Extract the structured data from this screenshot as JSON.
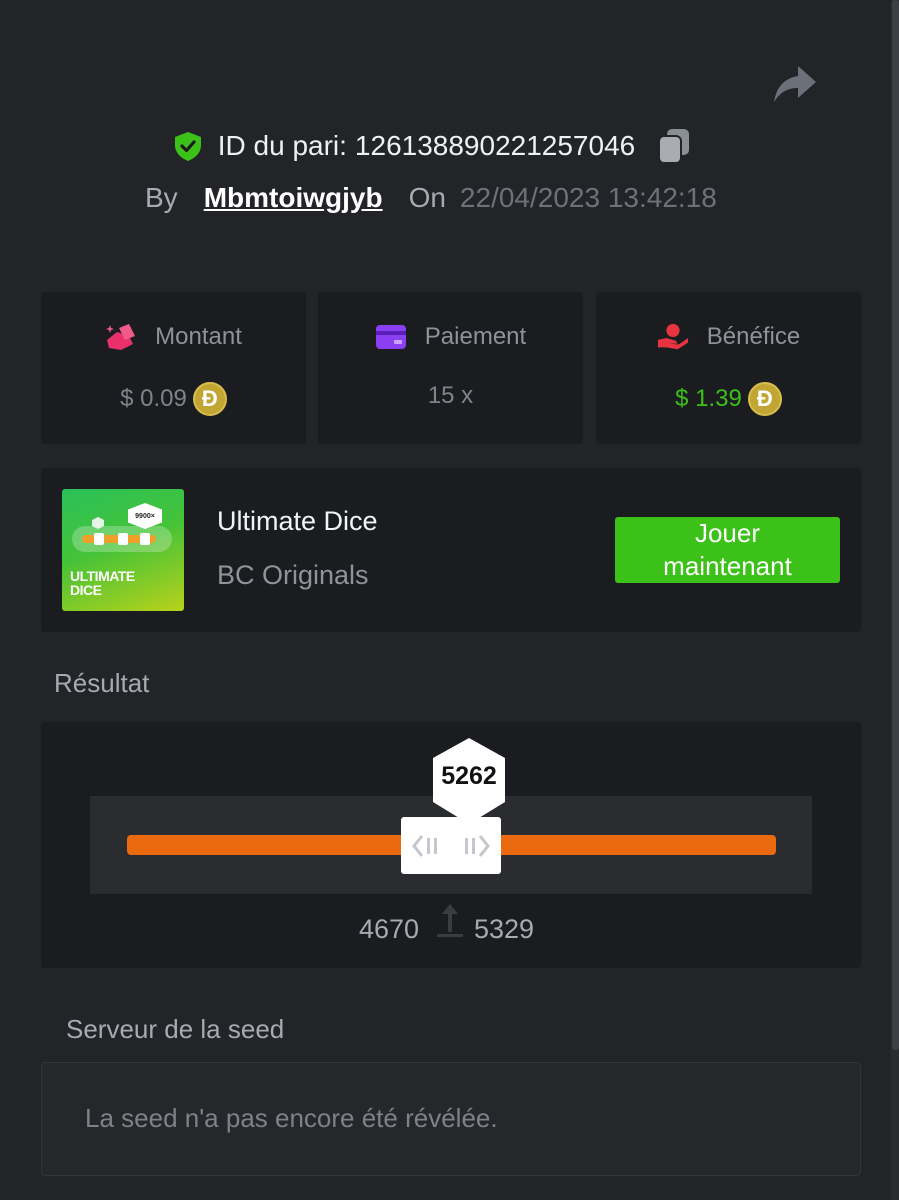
{
  "header": {
    "bet_id_label": "ID du pari:",
    "bet_id": "126138890221257046",
    "by_label": "By",
    "username": "Mbmtoiwgjyb",
    "on_label": "On",
    "datetime": "22/04/2023 13:42:18"
  },
  "stats": {
    "amount": {
      "label": "Montant",
      "value": "$ 0.09",
      "icon": "money-icon",
      "coin": "Đ"
    },
    "payout": {
      "label": "Paiement",
      "value": "15 x",
      "icon": "card-icon"
    },
    "profit": {
      "label": "Bénéfice",
      "value": "$ 1.39",
      "icon": "hand-coin-icon",
      "coin": "Đ"
    }
  },
  "game": {
    "title": "Ultimate Dice",
    "provider": "BC Originals",
    "thumb_label": "ULTIMATE DICE",
    "thumb_multiplier": "9900×",
    "play_button": "Jouer maintenant"
  },
  "result": {
    "section_title": "Résultat",
    "value": "5262",
    "range_low": "4670",
    "range_high": "5329"
  },
  "seed": {
    "section_title": "Serveur de la seed",
    "message": "La seed n'a pas encore été révélée."
  },
  "colors": {
    "background": "#232428",
    "card": "#1b1c1f",
    "accent_green": "#3bc117",
    "track_orange": "#eb6a10",
    "coin_gold": "#c2a633"
  }
}
